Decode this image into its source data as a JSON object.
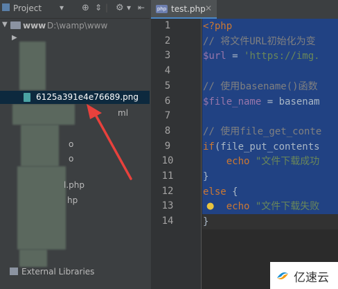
{
  "project_panel": {
    "title": "Project",
    "root_name": "www",
    "root_path": "D:\\wamp\\www",
    "selected_file": "6125a391e4e76689.png",
    "partial_names": [
      "ml",
      "o",
      "o",
      "l.php",
      "hp"
    ],
    "external_libraries": "External Libraries"
  },
  "editor": {
    "tab_label": "test.php",
    "line_numbers": [
      "1",
      "2",
      "3",
      "4",
      "5",
      "6",
      "7",
      "8",
      "9",
      "10",
      "11",
      "12",
      "13",
      "14"
    ],
    "lines": [
      [
        {
          "t": "<?php",
          "c": "kw"
        }
      ],
      [
        {
          "t": "// 将文件URL初始化为变",
          "c": "cm"
        }
      ],
      [
        {
          "t": "$url",
          "c": "var"
        },
        {
          "t": " = ",
          "c": "plain"
        },
        {
          "t": "'https://img.",
          "c": "str"
        }
      ],
      [],
      [
        {
          "t": "// 使用basename()函数",
          "c": "cm"
        }
      ],
      [
        {
          "t": "$file_name",
          "c": "var"
        },
        {
          "t": " = basenam",
          "c": "plain"
        }
      ],
      [],
      [
        {
          "t": "// 使用file_get_conte",
          "c": "cm"
        }
      ],
      [
        {
          "t": "if",
          "c": "kw"
        },
        {
          "t": "(file_put_contents",
          "c": "plain"
        }
      ],
      [
        {
          "t": "    echo ",
          "c": "kw"
        },
        {
          "t": "\"文件下载成功",
          "c": "str"
        }
      ],
      [
        {
          "t": "}",
          "c": "plain"
        }
      ],
      [
        {
          "t": "else",
          "c": "kw"
        },
        {
          "t": " {",
          "c": "plain"
        }
      ],
      [
        {
          "t": "    echo ",
          "c": "kw"
        },
        {
          "t": "\"文件下载失败",
          "c": "str"
        }
      ],
      [
        {
          "t": "}",
          "c": "plain"
        }
      ]
    ]
  },
  "watermark": {
    "text": "亿速云"
  },
  "colors": {
    "selection": "#214283",
    "accent": "#4a88c7",
    "arrow": "#e8413c"
  }
}
